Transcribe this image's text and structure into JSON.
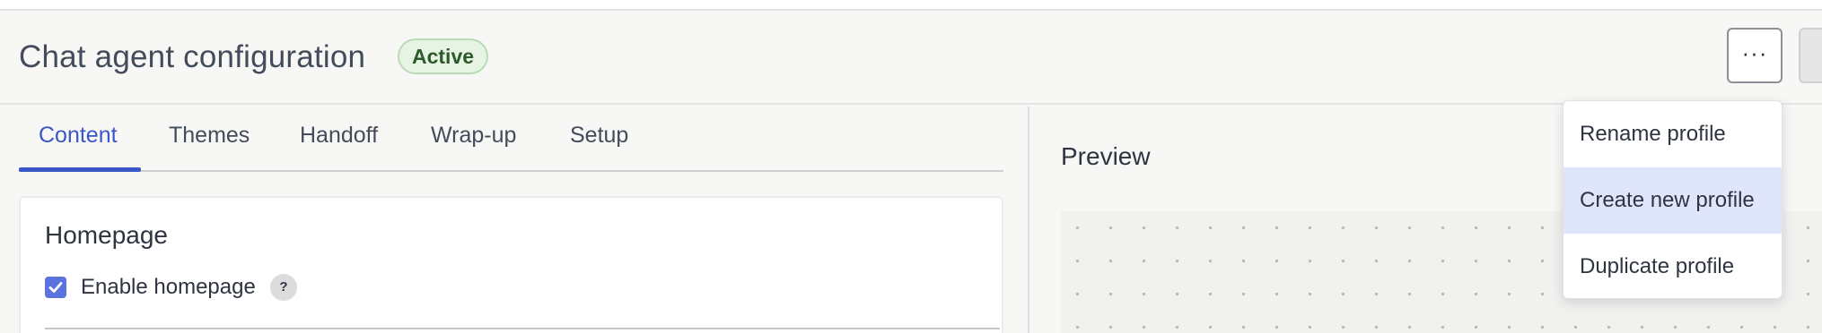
{
  "header": {
    "title": "Chat agent configuration",
    "status": "Active",
    "more_label": "···"
  },
  "tabs": [
    {
      "label": "Content",
      "active": true
    },
    {
      "label": "Themes",
      "active": false
    },
    {
      "label": "Handoff",
      "active": false
    },
    {
      "label": "Wrap-up",
      "active": false
    },
    {
      "label": "Setup",
      "active": false
    }
  ],
  "homepage": {
    "title": "Homepage",
    "enable_label": "Enable homepage",
    "enable_checked": true,
    "help": "?"
  },
  "preview": {
    "title": "Preview"
  },
  "menu": {
    "items": [
      {
        "label": "Rename profile"
      },
      {
        "label": "Create new profile"
      },
      {
        "label": "Duplicate profile"
      }
    ]
  },
  "colors": {
    "accent": "#3b56c9",
    "checkbox": "#5a73df",
    "badge_bg": "#e7f4e4",
    "badge_text": "#2c5a2a",
    "menu_highlight": "#dfe6fb"
  }
}
